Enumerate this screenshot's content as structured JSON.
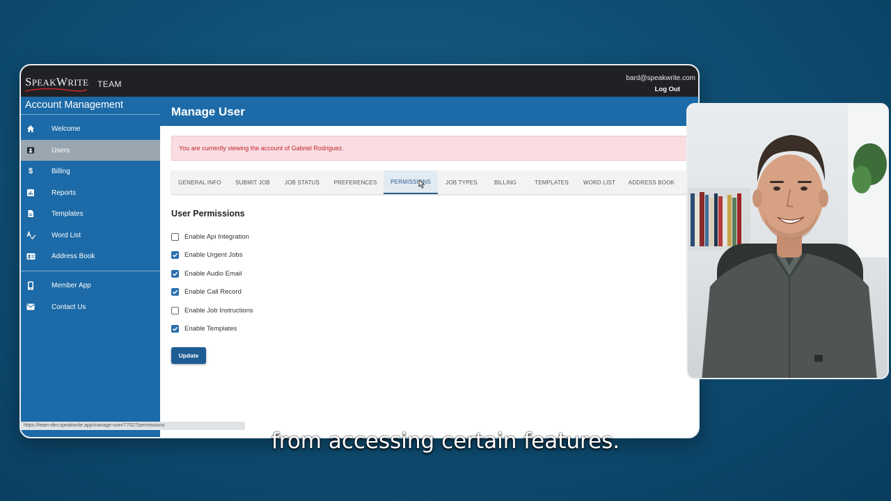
{
  "app": {
    "brand": "SpeakWrite",
    "team_label": "TEAM",
    "user_email": "bard@speakwrite.com",
    "logout_label": "Log Out"
  },
  "sidebar": {
    "title": "Account Management",
    "items": [
      {
        "label": "Welcome",
        "icon": "home-icon"
      },
      {
        "label": "Users",
        "icon": "users-icon",
        "active": true
      },
      {
        "label": "Billing",
        "icon": "dollar-icon"
      },
      {
        "label": "Reports",
        "icon": "reports-icon"
      },
      {
        "label": "Templates",
        "icon": "document-icon"
      },
      {
        "label": "Word List",
        "icon": "spellcheck-icon"
      },
      {
        "label": "Address Book",
        "icon": "contact-card-icon"
      },
      {
        "label": "Member App",
        "icon": "mobile-icon"
      },
      {
        "label": "Contact Us",
        "icon": "mail-icon"
      }
    ]
  },
  "main": {
    "title": "Manage User",
    "alert": "You are currently viewing the account of Gabriel Rodriguez.",
    "tabs": [
      {
        "label": "GENERAL INFO"
      },
      {
        "label": "SUBMIT JOB"
      },
      {
        "label": "JOB STATUS"
      },
      {
        "label": "PREFERENCES"
      },
      {
        "label": "PERMISSIONS",
        "active": true
      },
      {
        "label": "JOB TYPES"
      },
      {
        "label": "BILLING"
      },
      {
        "label": "TEMPLATES"
      },
      {
        "label": "WORD LIST"
      },
      {
        "label": "ADDRESS BOOK"
      }
    ],
    "section_title": "User Permissions",
    "permissions": [
      {
        "label": "Enable Api Integration",
        "checked": false
      },
      {
        "label": "Enable Urgent Jobs",
        "checked": true
      },
      {
        "label": "Enable Audio Email",
        "checked": true
      },
      {
        "label": "Enable Call Record",
        "checked": true
      },
      {
        "label": "Enable Job Instructions",
        "checked": false
      },
      {
        "label": "Enable Templates",
        "checked": true
      }
    ],
    "update_label": "Update"
  },
  "statusbar": {
    "url": "https://team-dev.speakwrite.app/manage-user/77027/permissions"
  },
  "caption": {
    "text": "from accessing certain features."
  },
  "colors": {
    "sidebar_blue": "#1c6aa7",
    "topbar": "#202124",
    "alert_bg": "#f9dde2",
    "alert_text": "#c0262d",
    "checkbox_checked": "#2b6fad",
    "button": "#1e5d93"
  }
}
